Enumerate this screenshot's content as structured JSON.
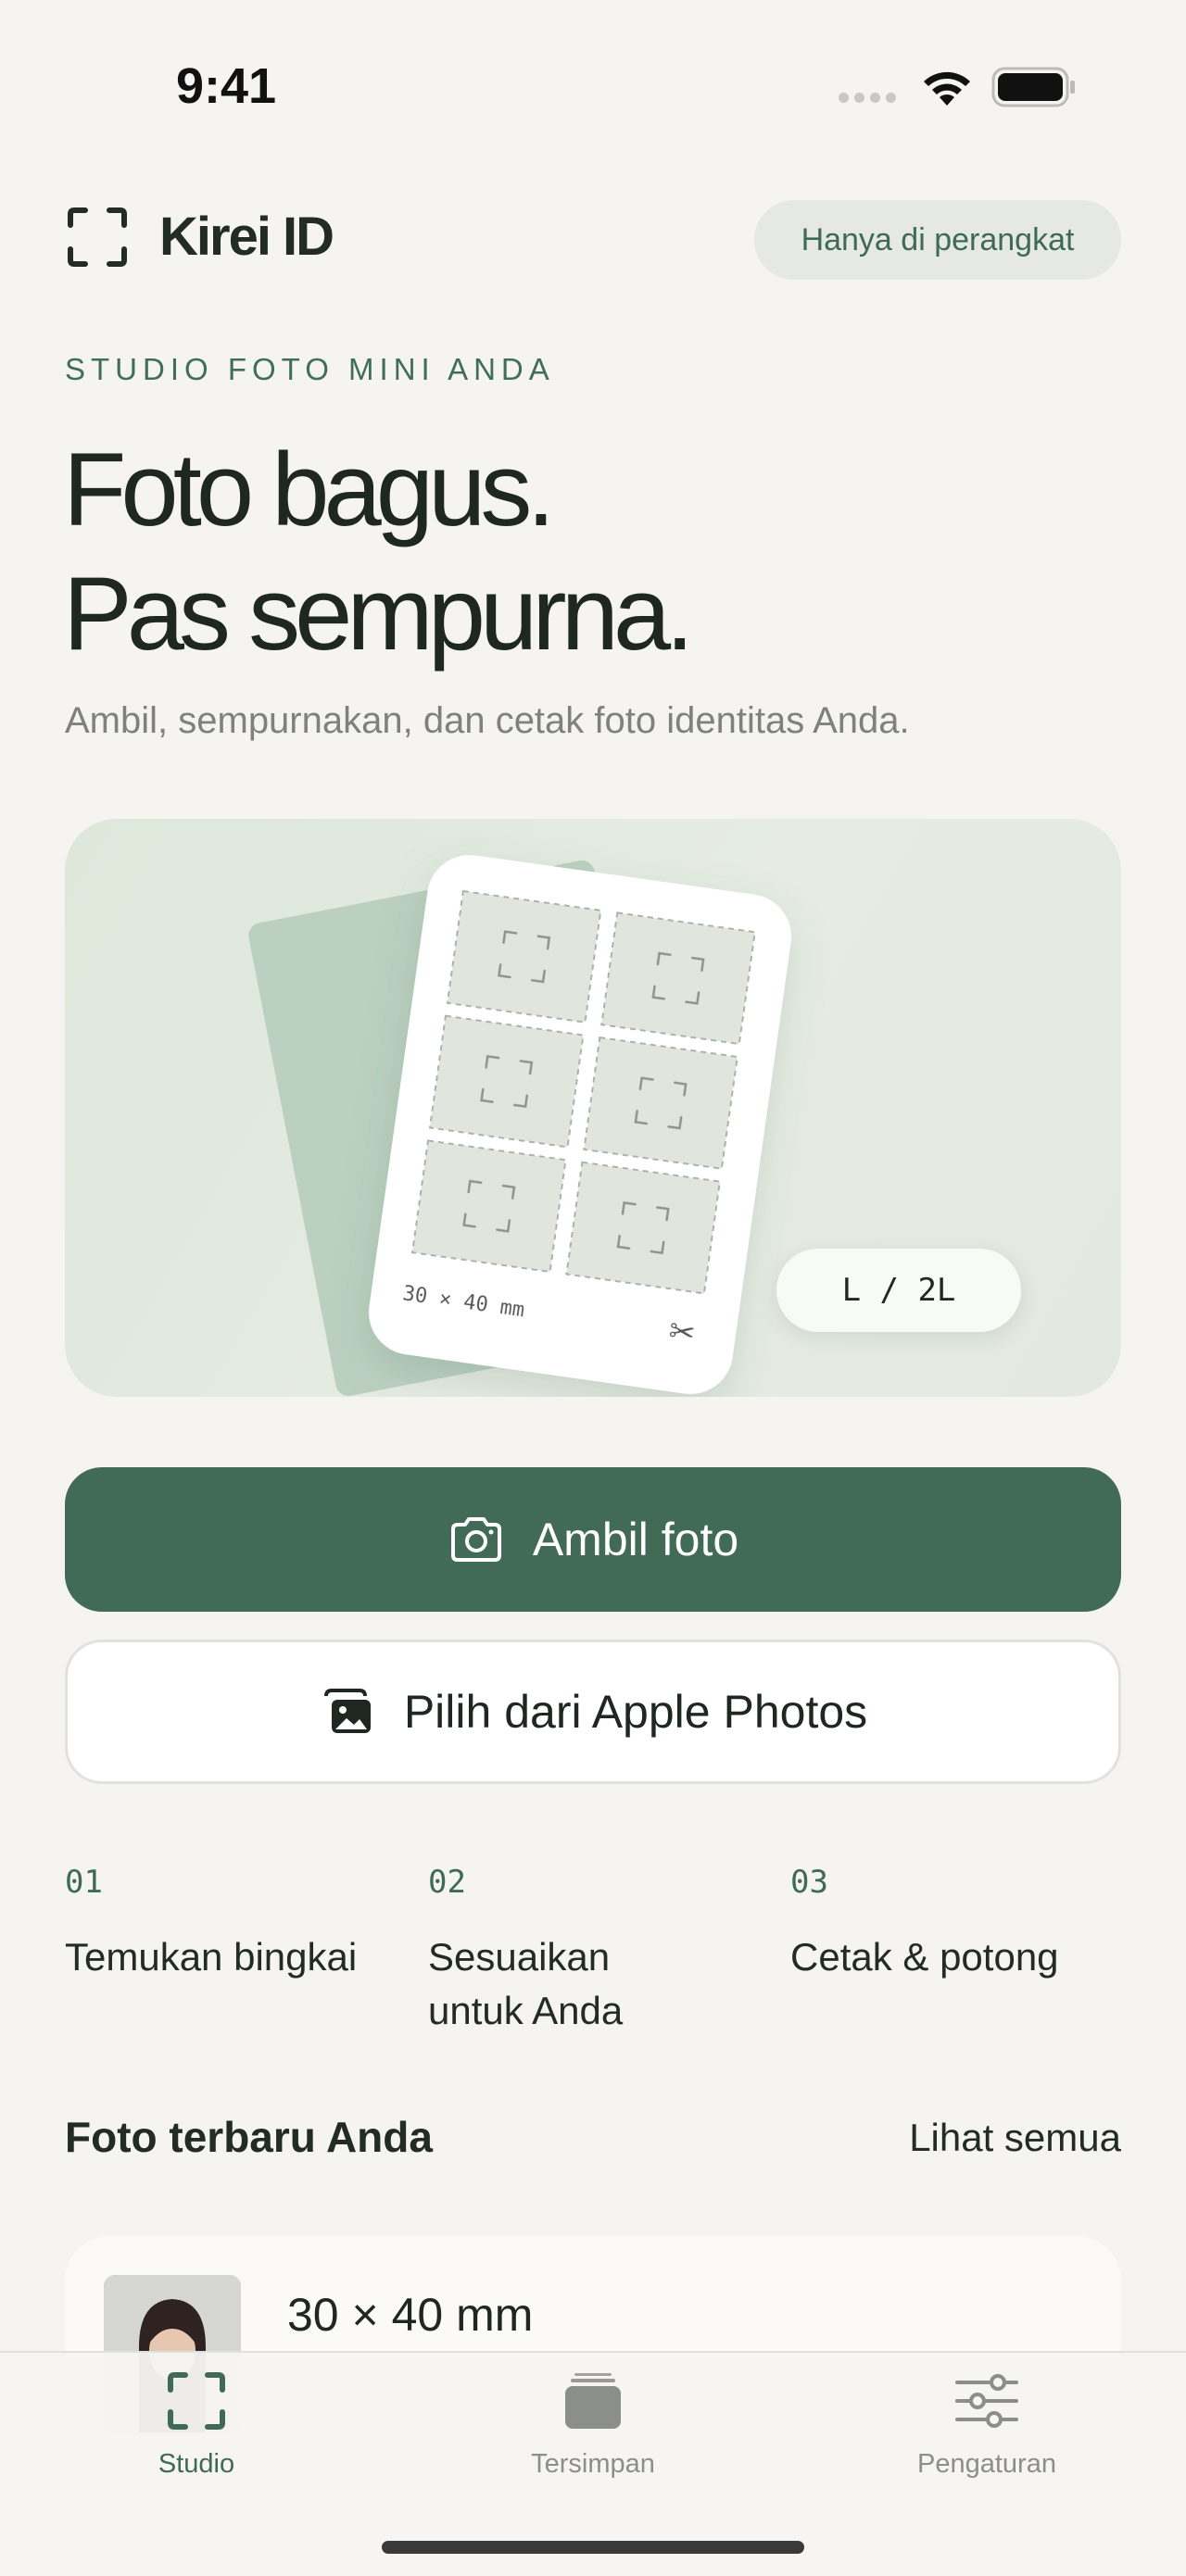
{
  "status_bar": {
    "time": "9:41"
  },
  "header": {
    "app_name": "Kirei ID",
    "device_badge": "Hanya di perangkat"
  },
  "hero": {
    "eyebrow": "STUDIO FOTO MINI ANDA",
    "headline_line1": "Foto bagus.",
    "headline_line2": "Pas sempurna.",
    "subtitle": "Ambil, sempurnakan, dan cetak foto identitas Anda.",
    "sheet_size_label": "30 × 40 mm",
    "paper_badge": "L / 2L",
    "accent_color": "#416a57"
  },
  "actions": {
    "take_photo": "Ambil foto",
    "choose_photos": "Pilih dari Apple Photos"
  },
  "steps": [
    {
      "number": "01",
      "label": "Temukan bingkai"
    },
    {
      "number": "02",
      "label": "Sesuaikan untuk Anda"
    },
    {
      "number": "03",
      "label": "Cetak & potong"
    }
  ],
  "recent": {
    "title": "Foto terbaru Anda",
    "see_all": "Lihat semua",
    "items": [
      {
        "size": "30 × 40 mm"
      }
    ]
  },
  "tab_bar": {
    "active_color": "#3f6a56",
    "inactive_color": "#8c8e8a",
    "tabs": [
      {
        "label": "Studio",
        "icon": "frame-icon",
        "active": true
      },
      {
        "label": "Tersimpan",
        "icon": "stack-icon",
        "active": false
      },
      {
        "label": "Pengaturan",
        "icon": "sliders-icon",
        "active": false
      }
    ]
  }
}
